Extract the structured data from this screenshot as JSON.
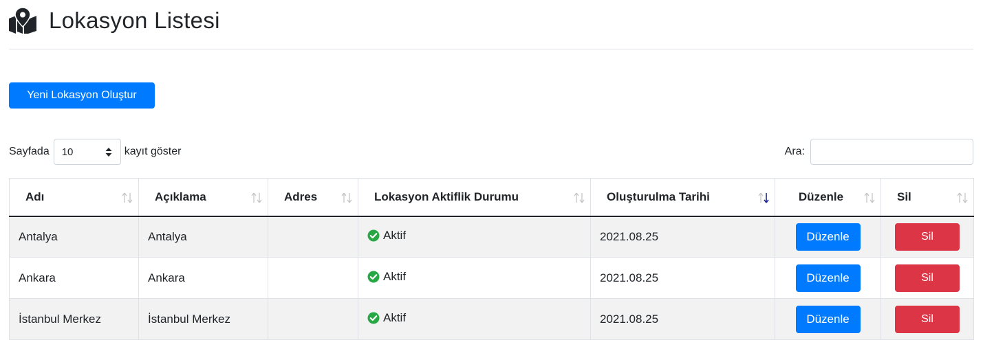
{
  "page": {
    "title": "Lokasyon Listesi",
    "icon": "map-marker-icon"
  },
  "toolbar": {
    "new_label": "Yeni Lokasyon Oluştur"
  },
  "length_control": {
    "prefix": "Sayfada",
    "value": "10",
    "suffix": "kayıt göster"
  },
  "search": {
    "label": "Ara:",
    "value": ""
  },
  "table": {
    "columns": [
      {
        "label": "Adı",
        "sort": "none"
      },
      {
        "label": "Açıklama",
        "sort": "none"
      },
      {
        "label": "Adres",
        "sort": "none"
      },
      {
        "label": "Lokasyon Aktiflik Durumu",
        "sort": "none"
      },
      {
        "label": "Oluşturulma Tarihi",
        "sort": "descending"
      },
      {
        "label": "Düzenle",
        "sort": "none"
      },
      {
        "label": "Sil",
        "sort": "none"
      }
    ],
    "rows": [
      {
        "name": "Antalya",
        "description": "Antalya",
        "address": "",
        "status": "Aktif",
        "created": "2021.08.25",
        "edit_label": "Düzenle",
        "delete_label": "Sil"
      },
      {
        "name": "Ankara",
        "description": "Ankara",
        "address": "",
        "status": "Aktif",
        "created": "2021.08.25",
        "edit_label": "Düzenle",
        "delete_label": "Sil"
      },
      {
        "name": "İstanbul Merkez",
        "description": "İstanbul Merkez",
        "address": "",
        "status": "Aktif",
        "created": "2021.08.25",
        "edit_label": "Düzenle",
        "delete_label": "Sil"
      }
    ]
  },
  "colors": {
    "primary": "#007bff",
    "danger": "#dc3545",
    "success": "#28a745",
    "stripe": "#f2f2f2"
  }
}
